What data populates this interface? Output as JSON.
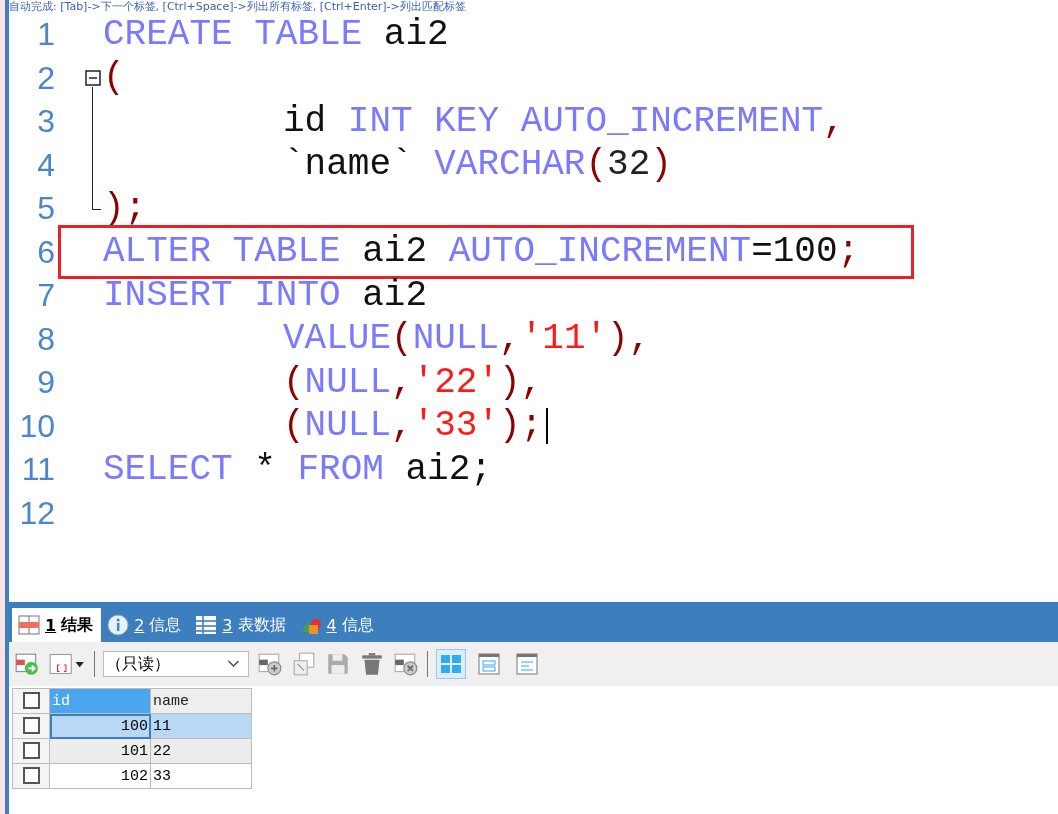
{
  "hint": "自动完成: [Tab]->下一个标签, [Ctrl+Space]->列出所有标签, [Ctrl+Enter]->列出匹配标签",
  "editor": {
    "lines": [
      {
        "number": "1",
        "kind": "statement",
        "highlighted": false,
        "cursor": false,
        "tokens": [
          {
            "kind": "kw",
            "text": "CREATE TABLE"
          },
          {
            "kind": "plain",
            "text": " ai2"
          }
        ]
      },
      {
        "number": "2",
        "kind": "statement",
        "highlighted": false,
        "cursor": false,
        "expanded": true,
        "tokens": [
          {
            "kind": "punct",
            "text": "("
          }
        ],
        "children": [
          {
            "number": "3",
            "kind": "continuation",
            "highlighted": false,
            "cursor": false,
            "tokens": [
              {
                "kind": "plain",
                "text": "id "
              },
              {
                "kind": "kw",
                "text": "INT KEY AUTO_INCREMENT"
              },
              {
                "kind": "punct",
                "text": ","
              }
            ]
          },
          {
            "number": "4",
            "kind": "continuation",
            "highlighted": false,
            "cursor": false,
            "tokens": [
              {
                "kind": "plain",
                "text": "`name` "
              },
              {
                "kind": "kw",
                "text": "VARCHAR"
              },
              {
                "kind": "punct",
                "text": "("
              },
              {
                "kind": "num",
                "text": "32"
              },
              {
                "kind": "punct",
                "text": ")"
              }
            ]
          },
          {
            "number": "5",
            "kind": "statement",
            "highlighted": false,
            "cursor": false,
            "tokens": [
              {
                "kind": "punct",
                "text": ");"
              }
            ]
          }
        ]
      },
      {
        "number": "6",
        "kind": "statement",
        "highlighted": true,
        "cursor": false,
        "tokens": [
          {
            "kind": "kw",
            "text": "ALTER TABLE"
          },
          {
            "kind": "plain",
            "text": " ai2 "
          },
          {
            "kind": "kw",
            "text": "AUTO_INCREMENT"
          },
          {
            "kind": "plain",
            "text": "=100"
          },
          {
            "kind": "punct",
            "text": ";"
          }
        ]
      },
      {
        "number": "7",
        "kind": "statement",
        "highlighted": false,
        "cursor": false,
        "tokens": [
          {
            "kind": "kw",
            "text": "INSERT INTO"
          },
          {
            "kind": "plain",
            "text": " ai2"
          }
        ]
      },
      {
        "number": "8",
        "kind": "continuation",
        "highlighted": false,
        "cursor": false,
        "tokens": [
          {
            "kind": "kw",
            "text": "VALUE"
          },
          {
            "kind": "punct",
            "text": "("
          },
          {
            "kind": "kw",
            "text": "NULL"
          },
          {
            "kind": "punct",
            "text": ","
          },
          {
            "kind": "str",
            "text": "'11'"
          },
          {
            "kind": "punct",
            "text": "),"
          }
        ]
      },
      {
        "number": "9",
        "kind": "continuation",
        "highlighted": false,
        "cursor": false,
        "tokens": [
          {
            "kind": "punct",
            "text": "("
          },
          {
            "kind": "kw",
            "text": "NULL"
          },
          {
            "kind": "punct",
            "text": ","
          },
          {
            "kind": "str",
            "text": "'22'"
          },
          {
            "kind": "punct",
            "text": "),"
          }
        ]
      },
      {
        "number": "10",
        "kind": "continuation",
        "highlighted": false,
        "cursor": true,
        "tokens": [
          {
            "kind": "punct",
            "text": "("
          },
          {
            "kind": "kw",
            "text": "NULL"
          },
          {
            "kind": "punct",
            "text": ","
          },
          {
            "kind": "str",
            "text": "'33'"
          },
          {
            "kind": "punct",
            "text": ");"
          }
        ]
      },
      {
        "number": "11",
        "kind": "statement",
        "highlighted": false,
        "cursor": false,
        "tokens": [
          {
            "kind": "kw",
            "text": "SELECT"
          },
          {
            "kind": "plain",
            "text": " * "
          },
          {
            "kind": "kw",
            "text": "FROM"
          },
          {
            "kind": "plain",
            "text": " ai2;"
          }
        ]
      },
      {
        "number": "12"
      }
    ]
  },
  "result_tabs": [
    {
      "key": "1",
      "label": "结果",
      "selected": true
    },
    {
      "key": "2",
      "label": "信息",
      "selected": false
    },
    {
      "key": "3",
      "label": "表数据",
      "selected": false
    },
    {
      "key": "4",
      "label": "信息",
      "selected": false
    }
  ],
  "toolbar": {
    "mode": "（只读）",
    "views": [
      {
        "selected": true
      },
      {
        "selected": false
      },
      {
        "selected": false
      }
    ]
  },
  "grid": {
    "header_checked": false,
    "columns": [
      {
        "label": "id",
        "selected": true
      },
      {
        "label": "name",
        "selected": false
      }
    ],
    "rows": [
      {
        "checked": false,
        "selected": true,
        "cells": [
          "100",
          "11"
        ]
      },
      {
        "checked": false,
        "selected": false,
        "cells": [
          "101",
          "22"
        ]
      },
      {
        "checked": false,
        "selected": false,
        "cells": [
          "102",
          "33"
        ]
      }
    ]
  }
}
